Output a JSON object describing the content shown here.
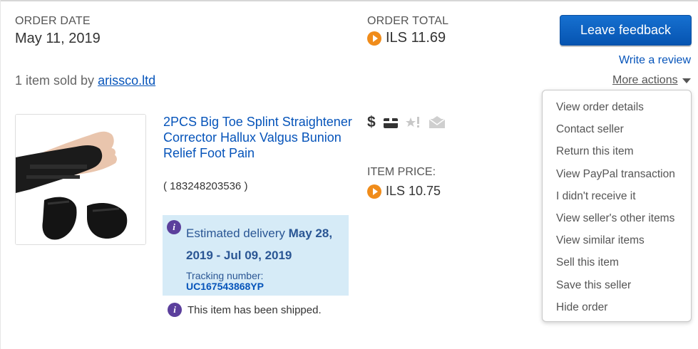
{
  "order": {
    "date_label": "ORDER DATE",
    "date_value": "May 11, 2019",
    "total_label": "ORDER TOTAL",
    "total_value": "ILS 11.69"
  },
  "actions": {
    "leave_feedback": "Leave feedback",
    "write_review": "Write a review",
    "more_actions": "More actions"
  },
  "seller": {
    "prefix": "1 item sold by ",
    "name": "arissco.ltd"
  },
  "item": {
    "title": "2PCS Big Toe Splint Straightener Corrector Hallux Valgus Bunion Relief Foot Pain",
    "id": "( 183248203536 )",
    "price_label": "ITEM PRICE:",
    "price_value": "ILS 10.75"
  },
  "delivery": {
    "est_prefix": "Estimated delivery ",
    "est_dates": "May 28, 2019 - Jul 09, 2019",
    "tracking_label": "Tracking number:",
    "tracking_number": "UC167543868YP",
    "shipped_text": "This item has been shipped."
  },
  "status_icons": [
    "dollar-icon",
    "package-icon",
    "star-feedback-icon",
    "mail-icon"
  ],
  "menu": [
    "View order details",
    "Contact seller",
    "Return this item",
    "View PayPal transaction",
    "I didn't receive it",
    "View seller's other items",
    "View similar items",
    "Sell this item",
    "Save this seller",
    "Hide order"
  ],
  "colors": {
    "link": "#0654ba",
    "button": "#0654b1",
    "coin": "#f08c1a",
    "info": "#5b3f9c",
    "delivery_bg": "#d6ebf7"
  }
}
